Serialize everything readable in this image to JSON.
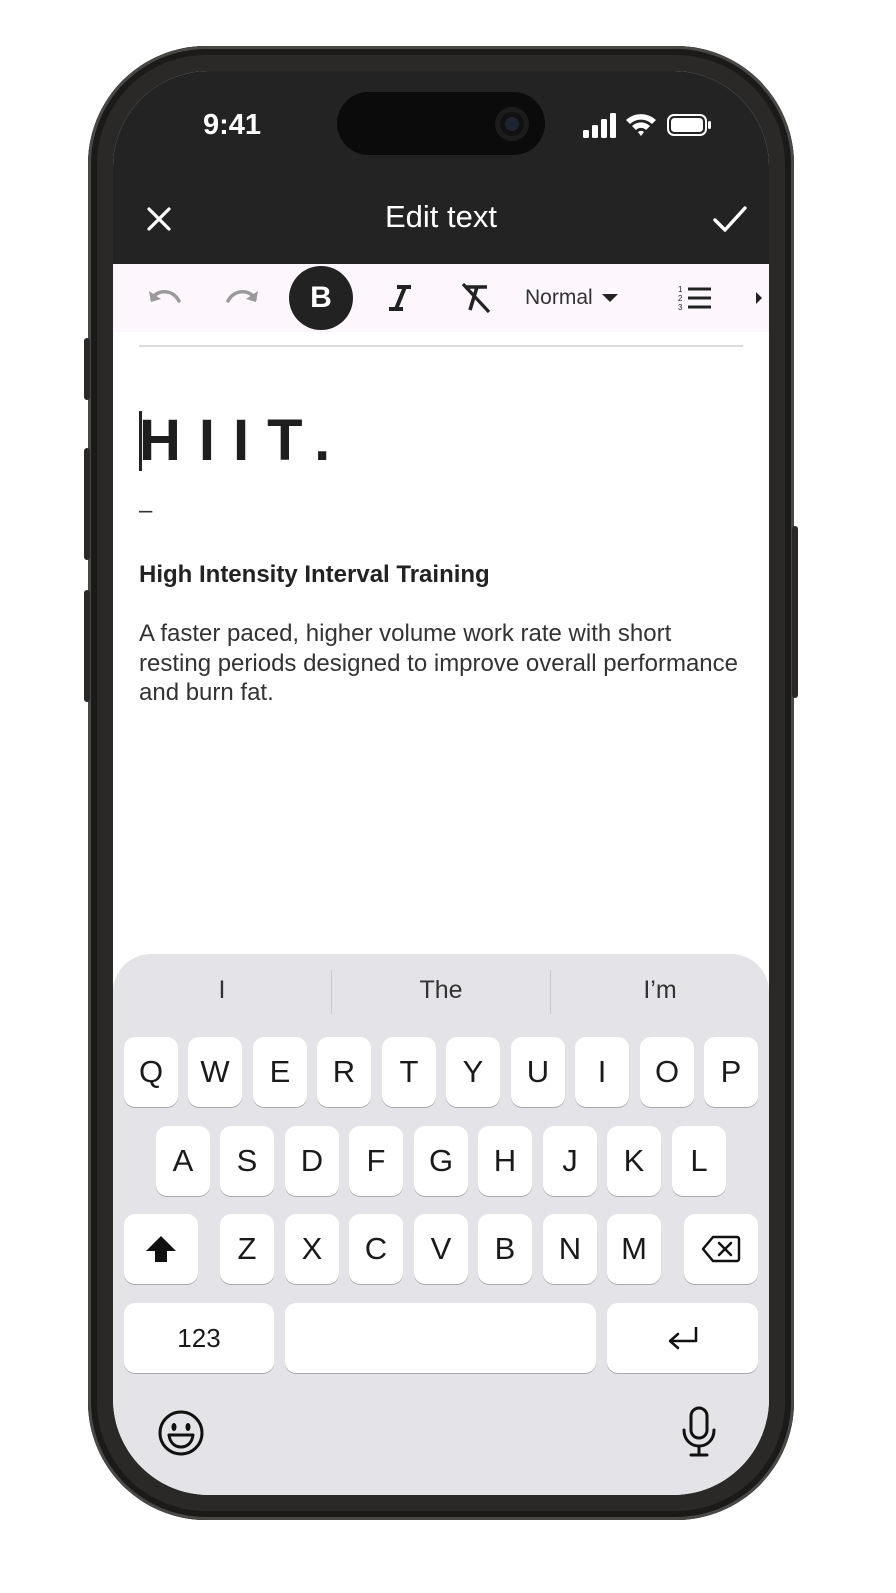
{
  "status_bar": {
    "time": "9:41",
    "icons": [
      "signal-icon",
      "wifi-icon",
      "battery-icon"
    ]
  },
  "header": {
    "title": "Edit text",
    "close_icon": "close-icon",
    "confirm_icon": "check-icon"
  },
  "toolbar": {
    "items": [
      "undo-icon",
      "redo-icon",
      "bold-icon",
      "italic-icon",
      "clear-format-icon",
      "numbered-list-icon",
      "more-right-icon"
    ],
    "bold_label": "B",
    "format_select": "Normal"
  },
  "document": {
    "heading": "HIIT.",
    "dash": "–",
    "subtitle": "High Intensity Interval Training",
    "body": "A faster paced, higher volume work rate with short resting periods designed to improve overall performance and burn fat."
  },
  "keyboard": {
    "suggestions": [
      "I",
      "The",
      "I’m"
    ],
    "row1": [
      "Q",
      "W",
      "E",
      "R",
      "T",
      "Y",
      "U",
      "I",
      "O",
      "P"
    ],
    "row2": [
      "A",
      "S",
      "D",
      "F",
      "G",
      "H",
      "J",
      "K",
      "L"
    ],
    "row3": [
      "Z",
      "X",
      "C",
      "V",
      "B",
      "N",
      "M"
    ],
    "numbers_label": "123",
    "icons": [
      "shift-icon",
      "backspace-icon",
      "return-icon",
      "emoji-icon",
      "microphone-icon"
    ]
  },
  "colors": {
    "top_bar": "#232323",
    "toolbar_bg": "#fdf6fd",
    "keyboard_bg": "#e4e4e8"
  }
}
